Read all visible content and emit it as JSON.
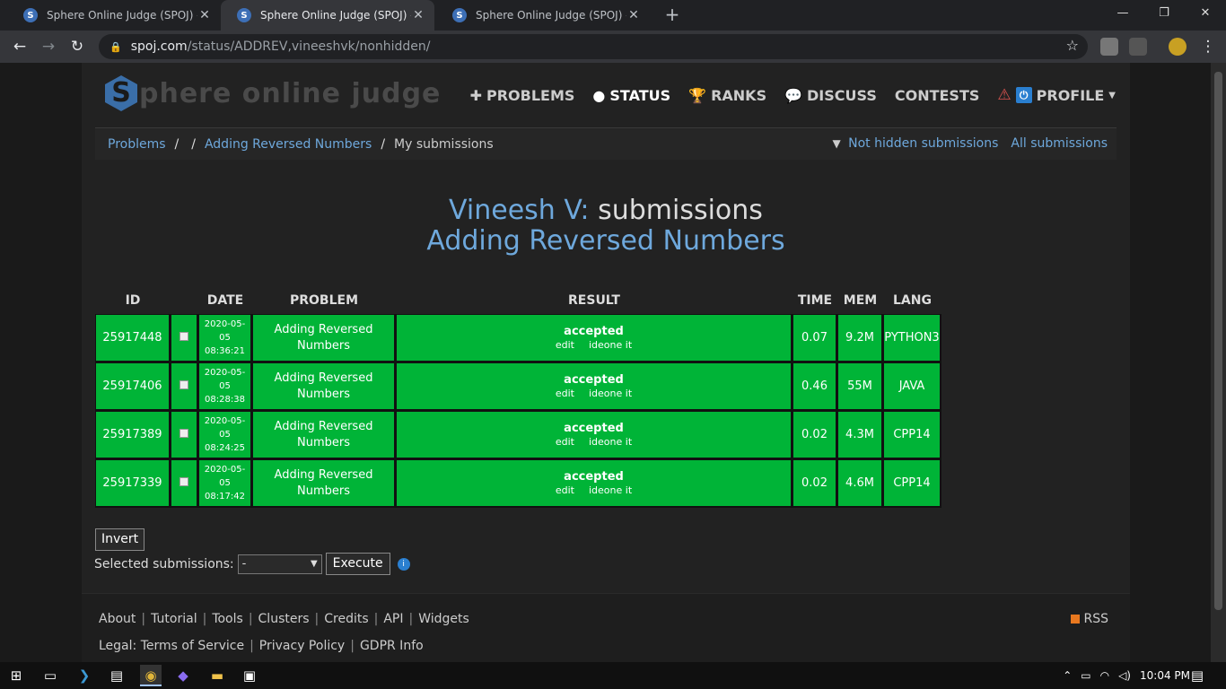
{
  "browser": {
    "tabs": [
      {
        "title": "Sphere Online Judge (SPOJ) - Pro",
        "active": false
      },
      {
        "title": "Sphere Online Judge (SPOJ) - Sta",
        "active": true
      },
      {
        "title": "Sphere Online Judge (SPOJ) - Sta",
        "active": false
      }
    ],
    "url_host": "spoj.com",
    "url_path": "/status/ADDREV,vineeshvk/nonhidden/"
  },
  "site": {
    "logo_letter": "S",
    "logo_text": "phere online judge",
    "nav": [
      {
        "label": "PROBLEMS",
        "icon": "puzzle-icon"
      },
      {
        "label": "STATUS",
        "icon": "circle-icon"
      },
      {
        "label": "RANKS",
        "icon": "trophy-icon"
      },
      {
        "label": "DISCUSS",
        "icon": "chat-icon"
      },
      {
        "label": "CONTESTS",
        "icon": ""
      },
      {
        "label": "PROFILE",
        "icon": "power-icon"
      }
    ]
  },
  "breadcrumb": {
    "problems": "Problems",
    "problem": "Adding Reversed Numbers",
    "current": "My submissions",
    "not_hidden": "Not hidden submissions",
    "all": "All submissions"
  },
  "heading": {
    "user": "Vineesh V:",
    "suffix": "submissions",
    "problem": "Adding Reversed Numbers"
  },
  "table": {
    "headers": {
      "id": "ID",
      "date": "DATE",
      "problem": "PROBLEM",
      "result": "RESULT",
      "time": "TIME",
      "mem": "MEM",
      "lang": "LANG"
    },
    "rows": [
      {
        "id": "25917448",
        "date": "2020-05-05",
        "clock": "08:36:21",
        "problem1": "Adding Reversed",
        "problem2": "Numbers",
        "result": "accepted",
        "edit": "edit",
        "ideone": "ideone it",
        "time": "0.07",
        "mem": "9.2M",
        "lang": "PYTHON3"
      },
      {
        "id": "25917406",
        "date": "2020-05-05",
        "clock": "08:28:38",
        "problem1": "Adding Reversed",
        "problem2": "Numbers",
        "result": "accepted",
        "edit": "edit",
        "ideone": "ideone it",
        "time": "0.46",
        "mem": "55M",
        "lang": "JAVA"
      },
      {
        "id": "25917389",
        "date": "2020-05-05",
        "clock": "08:24:25",
        "problem1": "Adding Reversed",
        "problem2": "Numbers",
        "result": "accepted",
        "edit": "edit",
        "ideone": "ideone it",
        "time": "0.02",
        "mem": "4.3M",
        "lang": "CPP14"
      },
      {
        "id": "25917339",
        "date": "2020-05-05",
        "clock": "08:17:42",
        "problem1": "Adding Reversed",
        "problem2": "Numbers",
        "result": "accepted",
        "edit": "edit",
        "ideone": "ideone it",
        "time": "0.02",
        "mem": "4.6M",
        "lang": "CPP14"
      }
    ],
    "row_color": "#00b437"
  },
  "actions": {
    "invert": "Invert",
    "selected_label": "Selected submissions:",
    "selected_value": "-",
    "execute": "Execute"
  },
  "footer": {
    "links": [
      "About",
      "Tutorial",
      "Tools",
      "Clusters",
      "Credits",
      "API",
      "Widgets"
    ],
    "legal_prefix": "Legal:",
    "legal": [
      "Terms of Service",
      "Privacy Policy",
      "GDPR Info"
    ],
    "rss": "RSS"
  },
  "taskbar": {
    "time": "10:04 PM"
  }
}
